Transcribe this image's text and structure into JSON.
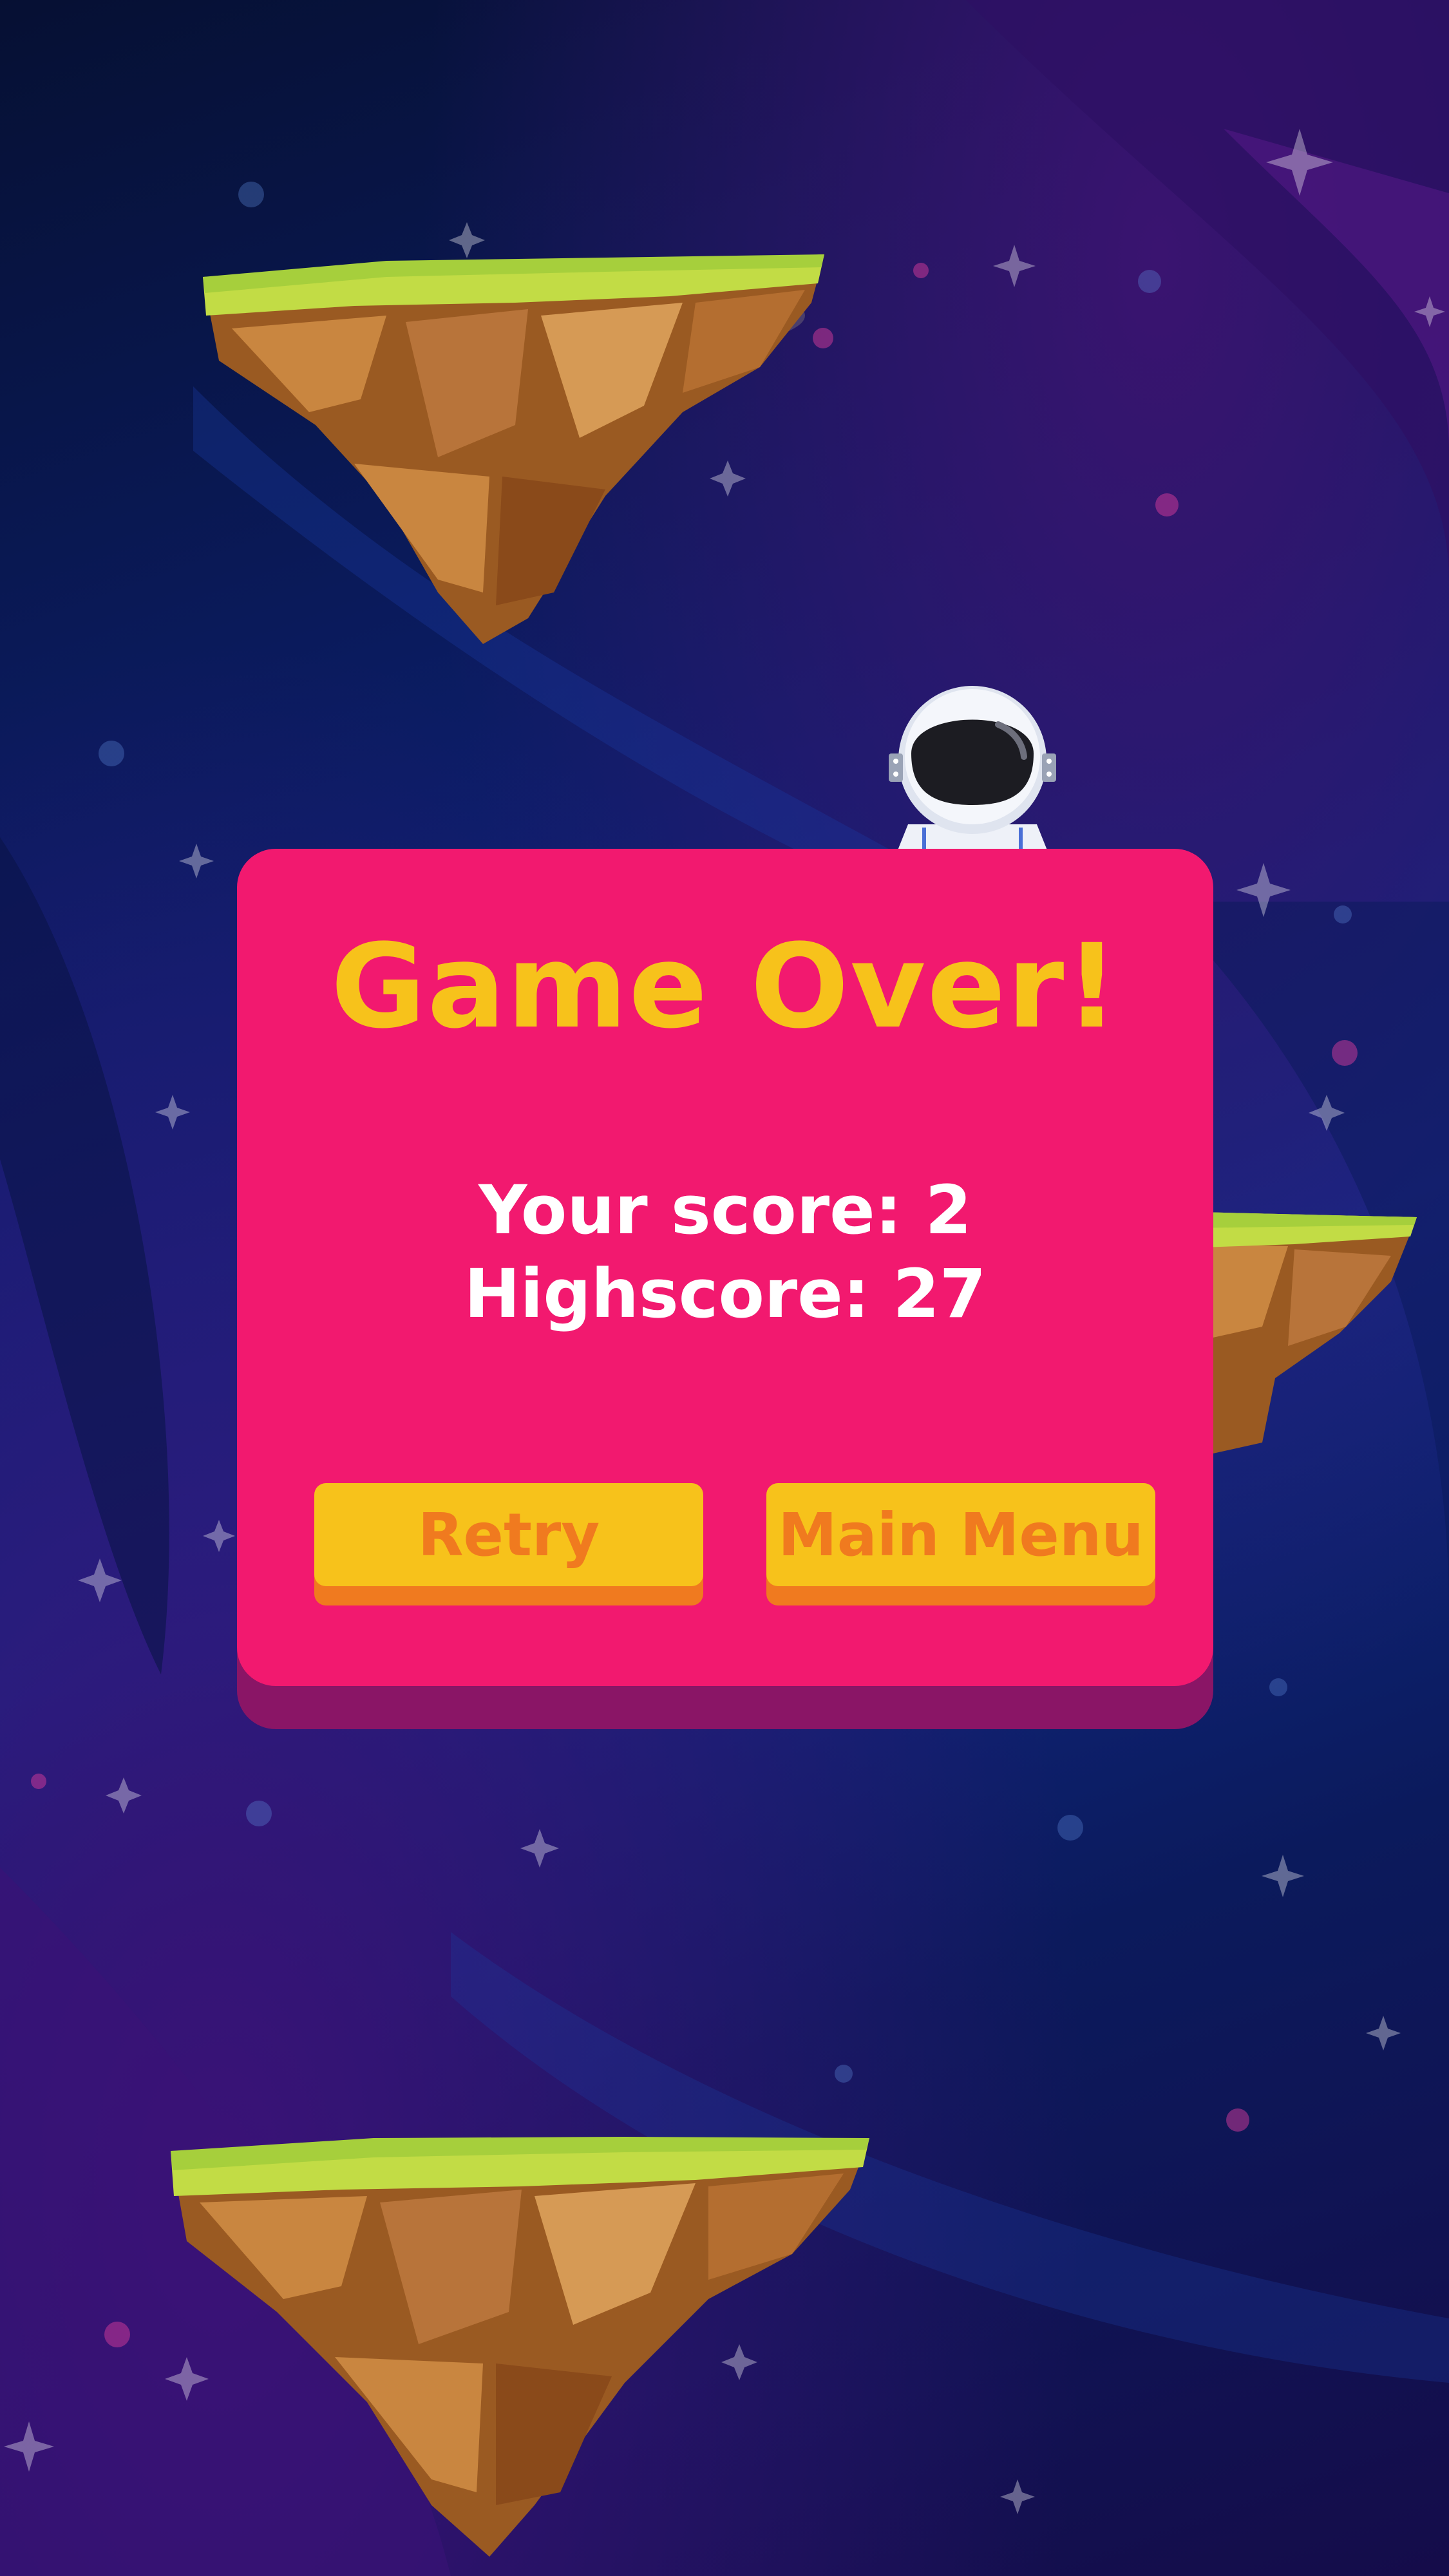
{
  "dialog": {
    "title": "Game Over!",
    "score_text": "Your score: 2",
    "highscore_text": "Highscore: 27"
  },
  "buttons": {
    "retry_label": "Retry",
    "main_menu_label": "Main Menu"
  },
  "colors": {
    "panel": "#f2196f",
    "panel_shadow": "#8a1566",
    "title": "#f7c21b",
    "button_face": "#f7c21b",
    "button_edge": "#f07a1f",
    "button_text": "#f07a1f",
    "score_text": "#ffffff"
  },
  "icons": {
    "player": "astronaut-icon",
    "platform": "floating-island-icon",
    "decoration": "star-icon"
  }
}
